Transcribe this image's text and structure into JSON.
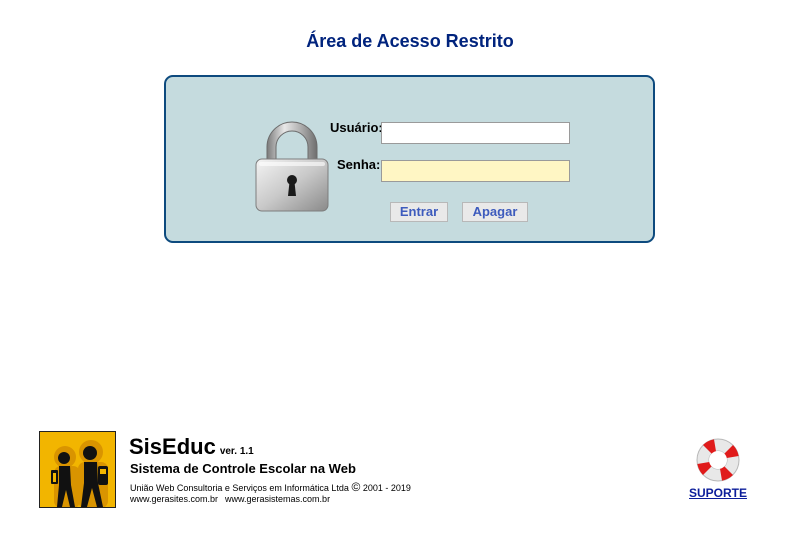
{
  "header": {
    "title": "Área de Acesso Restrito"
  },
  "login": {
    "username_label": "Usuário:",
    "username_value": "",
    "password_label": "Senha:",
    "password_value": "",
    "submit_label": "Entrar",
    "clear_label": "Apagar",
    "lock_icon": "padlock-icon"
  },
  "footer": {
    "logo_icon": "students-logo-icon",
    "app_name": "SisEduc",
    "version": "ver. 1.1",
    "subtitle": "Sistema de Controle Escolar na Web",
    "company": "União Web Consultoria e Serviços em Informática Ltda",
    "copyright_symbol": "©",
    "years": "2001 - 2019",
    "site_1": "www.gerasites.com.br",
    "site_2": "www.gerasistemas.com.br"
  },
  "support": {
    "icon": "lifebuoy-icon",
    "label": "SUPORTE"
  },
  "colors": {
    "title": "#00237d",
    "panel_background": "#c5dbde",
    "panel_border": "#0d4a7e",
    "password_field": "#fff6c4",
    "button_text": "#3d5bbd",
    "logo_background": "#f2b500",
    "support_link": "#0b1d9a"
  }
}
